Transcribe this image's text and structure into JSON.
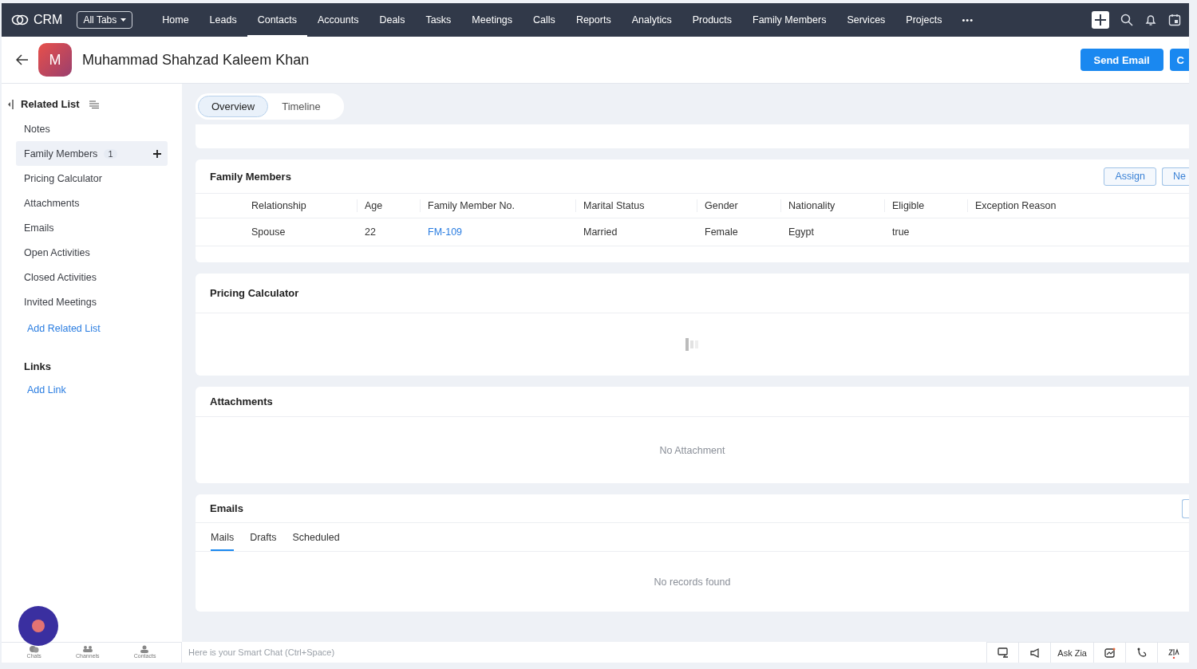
{
  "app": {
    "name": "CRM",
    "all_tabs": "All Tabs"
  },
  "nav_tabs": [
    {
      "label": "Home",
      "selected": false
    },
    {
      "label": "Leads",
      "selected": false
    },
    {
      "label": "Contacts",
      "selected": true
    },
    {
      "label": "Accounts",
      "selected": false
    },
    {
      "label": "Deals",
      "selected": false
    },
    {
      "label": "Tasks",
      "selected": false
    },
    {
      "label": "Meetings",
      "selected": false
    },
    {
      "label": "Calls",
      "selected": false
    },
    {
      "label": "Reports",
      "selected": false
    },
    {
      "label": "Analytics",
      "selected": false
    },
    {
      "label": "Products",
      "selected": false
    },
    {
      "label": "Family Members",
      "selected": false
    },
    {
      "label": "Services",
      "selected": false
    },
    {
      "label": "Projects",
      "selected": false
    }
  ],
  "more": "•••",
  "record": {
    "initial": "M",
    "name": "Muhammad Shahzad Kaleem Khan"
  },
  "header_buttons": [
    "Send Email",
    "C"
  ],
  "sidebar": {
    "title": "Related List",
    "items": [
      {
        "label": "Notes",
        "selected": false
      },
      {
        "label": "Family Members",
        "count": "1",
        "selected": true
      },
      {
        "label": "Pricing Calculator",
        "selected": false
      },
      {
        "label": "Attachments",
        "selected": false
      },
      {
        "label": "Emails",
        "selected": false
      },
      {
        "label": "Open Activities",
        "selected": false
      },
      {
        "label": "Closed Activities",
        "selected": false
      },
      {
        "label": "Invited Meetings",
        "selected": false
      }
    ],
    "add_related_list": "Add Related List",
    "links_title": "Links",
    "add_link": "Add Link"
  },
  "view_tabs": [
    {
      "label": "Overview",
      "selected": true
    },
    {
      "label": "Timeline",
      "selected": false
    }
  ],
  "family_members": {
    "title": "Family Members",
    "buttons": [
      "Assign",
      "Ne"
    ],
    "columns": [
      "Relationship",
      "Age",
      "Family Member No.",
      "Marital Status",
      "Gender",
      "Nationality",
      "Eligible",
      "Exception Reason"
    ],
    "rows": [
      {
        "cells": [
          {
            "text": "Spouse",
            "kind": "text"
          },
          {
            "text": "22",
            "kind": "text"
          },
          {
            "text": "FM-109",
            "kind": "link"
          },
          {
            "text": "Married",
            "kind": "text"
          },
          {
            "text": "Female",
            "kind": "text"
          },
          {
            "text": "Egypt",
            "kind": "text"
          },
          {
            "text": "true",
            "kind": "text"
          }
        ]
      }
    ]
  },
  "pricing_calculator": {
    "title": "Pricing Calculator"
  },
  "attachments": {
    "title": "Attachments",
    "empty": "No Attachment"
  },
  "emails": {
    "title": "Emails",
    "tabs": [
      {
        "label": "Mails",
        "selected": true
      },
      {
        "label": "Drafts",
        "selected": false
      },
      {
        "label": "Scheduled",
        "selected": false
      }
    ],
    "empty": "No records found"
  },
  "footer": {
    "dock": [
      "Chats",
      "Channels",
      "Contacts"
    ],
    "smart_chat_placeholder": "Here is your Smart Chat (Ctrl+Space)",
    "ask_zia": "Ask Zia"
  }
}
